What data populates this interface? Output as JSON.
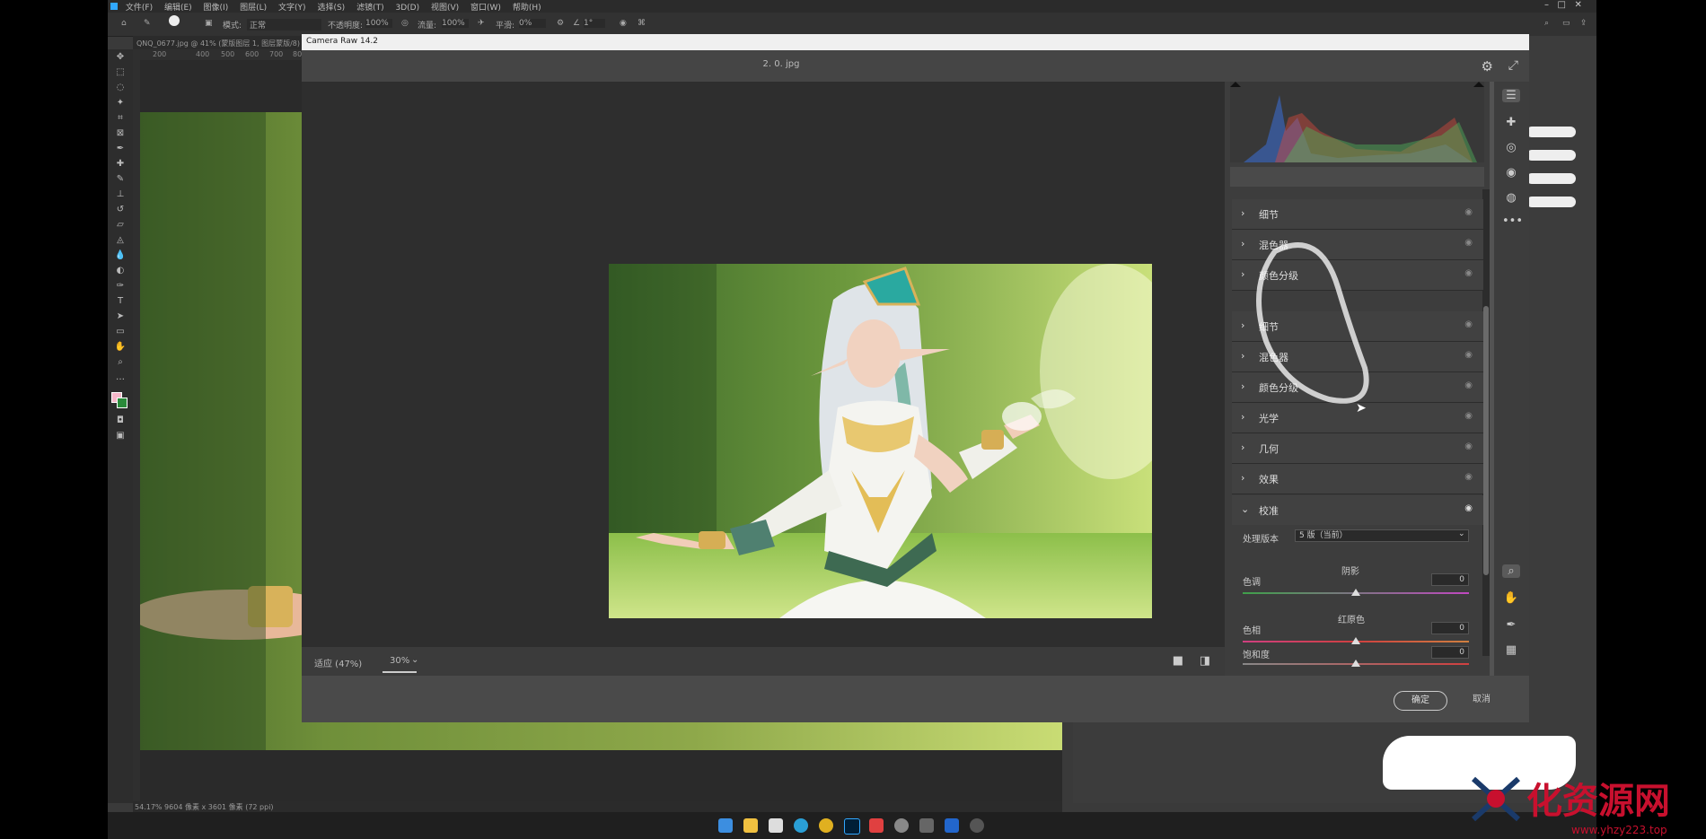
{
  "ps": {
    "menu": [
      "文件(F)",
      "编辑(E)",
      "图像(I)",
      "图层(L)",
      "文字(Y)",
      "选择(S)",
      "滤镜(T)",
      "3D(D)",
      "视图(V)",
      "窗口(W)",
      "帮助(H)"
    ],
    "options": {
      "mode_label": "模式:",
      "mode_value": "正常",
      "opacity_label": "不透明度:",
      "opacity_value": "100%",
      "flow_label": "流量:",
      "flow_value": "100%",
      "smooth_label": "平滑:",
      "smooth_value": "0%",
      "angle_value": "1°"
    },
    "tab_title": "QNQ_0677.jpg @ 41% (蒙版图层 1, 图层蒙版/8) *",
    "ruler_ticks": [
      "200",
      "400",
      "500",
      "600",
      "700",
      "800",
      "900"
    ],
    "status": "54.17%    9604 像素 x 3601 像素 (72 ppi)"
  },
  "cr": {
    "window_title": "Camera Raw 14.2",
    "filename": "2. 0. jpg",
    "zoom_fit": "适应 (47%)",
    "zoom_value": "30%",
    "sections": [
      {
        "label": "细节",
        "state": "collapsed"
      },
      {
        "label": "混色器",
        "state": "collapsed"
      },
      {
        "label": "颜色分级",
        "state": "collapsed"
      },
      {
        "label": "细节",
        "state": "collapsed"
      },
      {
        "label": "混色器",
        "state": "collapsed"
      },
      {
        "label": "颜色分级",
        "state": "collapsed"
      },
      {
        "label": "光学",
        "state": "collapsed"
      },
      {
        "label": "几何",
        "state": "collapsed"
      },
      {
        "label": "效果",
        "state": "collapsed"
      }
    ],
    "calibration": {
      "title": "校准",
      "process_label": "处理版本",
      "process_value": "5 版（当前）",
      "shadows_heading": "阴影",
      "tint_label": "色调",
      "tint_value": "0",
      "red_heading": "红原色",
      "hue_label": "色相",
      "hue_value": "0",
      "sat_label": "饱和度",
      "sat_value": "0"
    },
    "ok_label": "确定",
    "cancel_label": "取消"
  },
  "watermark": {
    "text": "化资源网",
    "url": "www.yhzy223.top"
  },
  "colors": {
    "histogram_blue": "#3b6fd8",
    "histogram_red": "#d84a3b",
    "histogram_green": "#4fb35a",
    "watermark_red": "#c8102e"
  }
}
